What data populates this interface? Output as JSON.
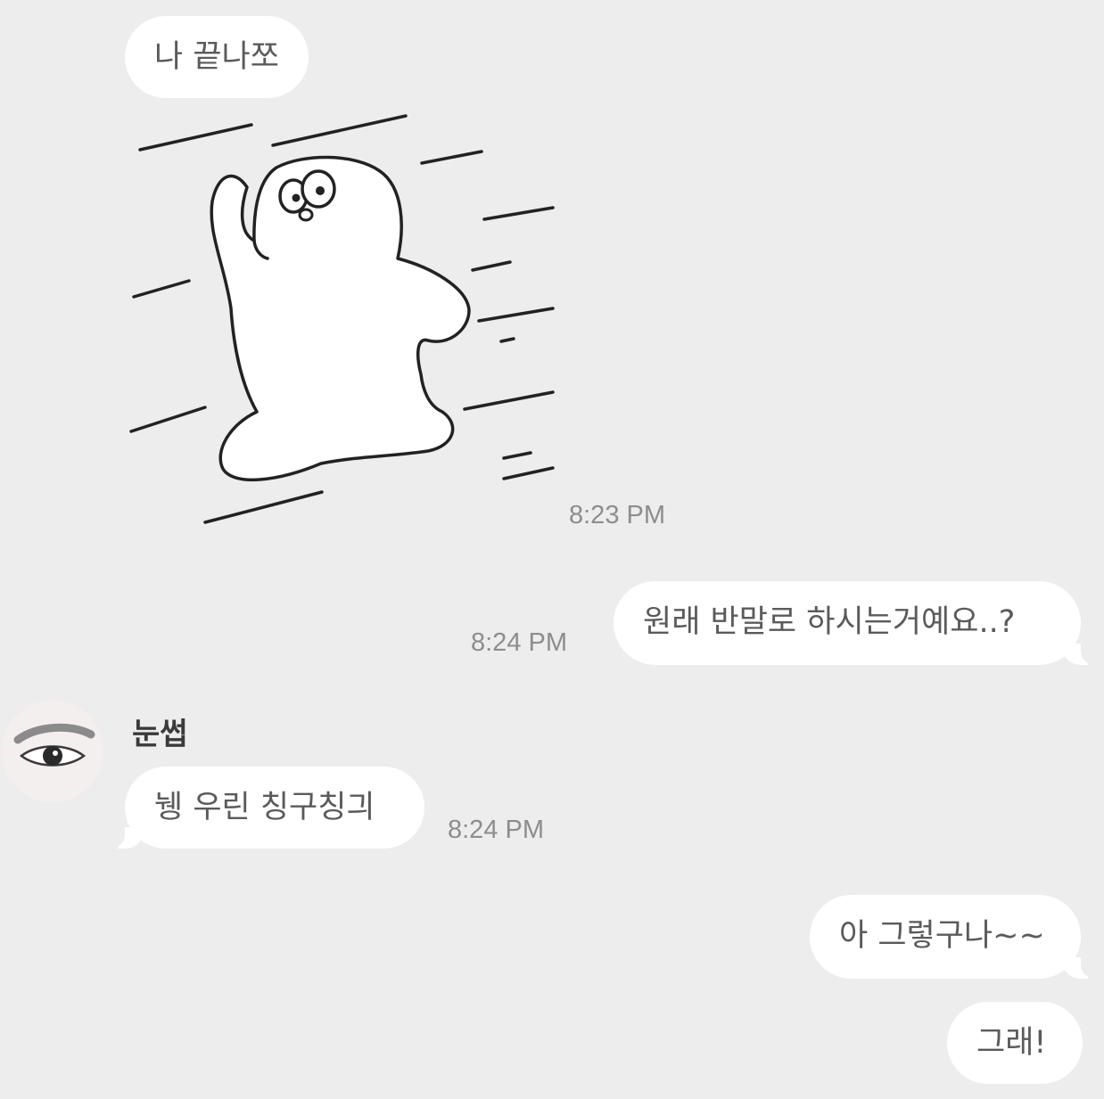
{
  "messages": {
    "m1": {
      "text": "나 끝나쪼"
    },
    "m2": {
      "time": "8:23 PM"
    },
    "m3": {
      "text": "원래 반말로 하시는거예요..?",
      "time": "8:24 PM"
    },
    "m4": {
      "sender": "눈썹",
      "text": "뉑 우린 칭구칭긔",
      "time": "8:24 PM"
    },
    "m5": {
      "text": "아 그렇구나~~"
    },
    "m6": {
      "text": "그래!"
    }
  },
  "icons": {
    "sticker": "waving-blob-sticker",
    "avatar": "eye-photo-avatar"
  },
  "colors": {
    "background": "#ededed",
    "bubble": "#ffffff",
    "text": "#5a5a5a",
    "timestamp": "#8d8d8d"
  }
}
